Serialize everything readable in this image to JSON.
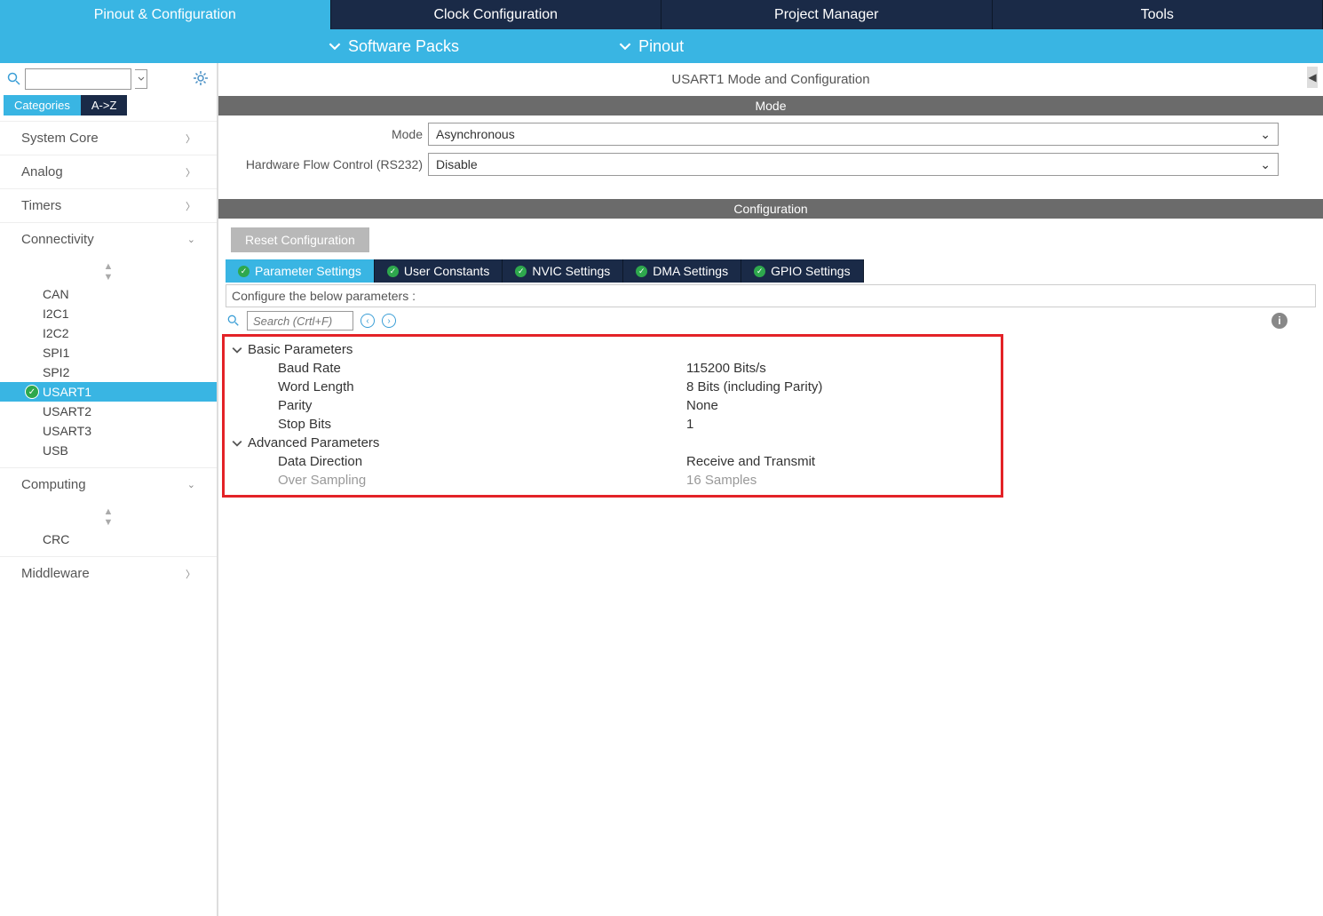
{
  "topTabs": [
    "Pinout & Configuration",
    "Clock Configuration",
    "Project Manager",
    "Tools"
  ],
  "subBar": {
    "softwarePacks": "Software Packs",
    "pinout": "Pinout"
  },
  "sidebar": {
    "tabs": {
      "categories": "Categories",
      "az": "A->Z"
    },
    "categories": [
      {
        "name": "System Core",
        "expanded": false
      },
      {
        "name": "Analog",
        "expanded": false
      },
      {
        "name": "Timers",
        "expanded": false
      },
      {
        "name": "Connectivity",
        "expanded": true,
        "items": [
          "CAN",
          "I2C1",
          "I2C2",
          "SPI1",
          "SPI2",
          "USART1",
          "USART2",
          "USART3",
          "USB"
        ],
        "selected": "USART1"
      },
      {
        "name": "Computing",
        "expanded": true,
        "items": [
          "CRC"
        ]
      },
      {
        "name": "Middleware",
        "expanded": false
      }
    ]
  },
  "panel": {
    "title": "USART1 Mode and Configuration",
    "modeBar": "Mode",
    "modeRows": [
      {
        "label": "Mode",
        "value": "Asynchronous"
      },
      {
        "label": "Hardware Flow Control (RS232)",
        "value": "Disable"
      }
    ],
    "configBar": "Configuration",
    "resetBtn": "Reset Configuration",
    "configTabs": [
      "Parameter Settings",
      "User Constants",
      "NVIC Settings",
      "DMA Settings",
      "GPIO Settings"
    ],
    "paramsHeader": "Configure the below parameters :",
    "searchPlaceholder": "Search (Crtl+F)",
    "groups": [
      {
        "name": "Basic Parameters",
        "params": [
          {
            "name": "Baud Rate",
            "value": "115200 Bits/s"
          },
          {
            "name": "Word Length",
            "value": "8 Bits (including Parity)"
          },
          {
            "name": "Parity",
            "value": "None"
          },
          {
            "name": "Stop Bits",
            "value": "1"
          }
        ]
      },
      {
        "name": "Advanced Parameters",
        "params": [
          {
            "name": "Data Direction",
            "value": "Receive and Transmit"
          },
          {
            "name": "Over Sampling",
            "value": "16 Samples",
            "disabled": true
          }
        ]
      }
    ]
  }
}
